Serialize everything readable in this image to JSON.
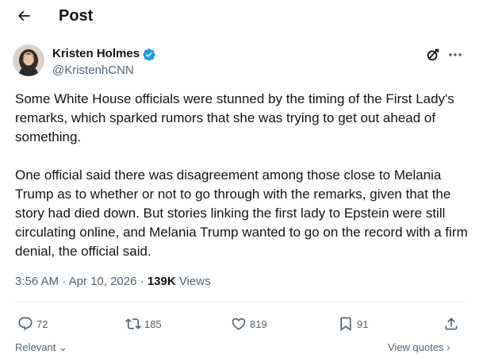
{
  "header": {
    "title": "Post",
    "back_icon": "arrow-left-icon"
  },
  "author": {
    "name": "Kristen Holmes",
    "handle": "@KristenhCNN",
    "verified": true,
    "verified_color": "#1d9bf0"
  },
  "tweet": {
    "paragraphs": [
      "Some White House officials were stunned by the timing of the First Lady's remarks, which sparked rumors that she was trying to get out ahead of something.",
      "One official said there was disagreement among those close to Melania Trump as to whether or not to go through with the remarks, given that the story had died down. But stories linking the first lady to Epstein were still circulating online, and Melania Trump wanted to go on the record with a firm denial, the official said."
    ],
    "time": "3:56 AM",
    "separator": "·",
    "date": "Apr 10, 2026",
    "views_count": "139K",
    "views_label": "Views"
  },
  "actions": {
    "replies": "72",
    "reposts": "185",
    "likes": "819",
    "bookmarks": "91"
  },
  "footer": {
    "left_label": "Relevant",
    "right_label": "View quotes"
  },
  "colors": {
    "text": "#0f1419",
    "secondary": "#536471",
    "accent": "#1d9bf0"
  }
}
